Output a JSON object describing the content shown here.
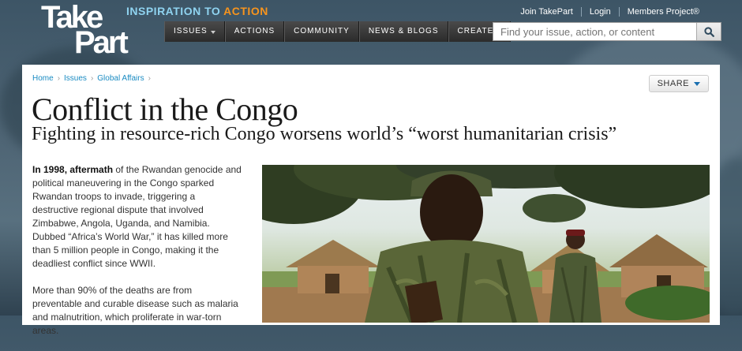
{
  "brand": {
    "logo_line1": "Take",
    "logo_line2": "Part",
    "tagline_prefix": "INSPIRATION TO",
    "tagline_accent": "ACTION"
  },
  "utility_links": [
    "Join TakePart",
    "Login",
    "Members Project®"
  ],
  "nav": [
    {
      "label": "ISSUES",
      "has_caret": true
    },
    {
      "label": "ACTIONS",
      "has_caret": false
    },
    {
      "label": "COMMUNITY",
      "has_caret": false
    },
    {
      "label": "NEWS & BLOGS",
      "has_caret": false
    },
    {
      "label": "CREATE",
      "has_caret": true
    }
  ],
  "search": {
    "placeholder": "Find your issue, action, or content",
    "icon": "search-icon"
  },
  "breadcrumb": [
    "Home",
    "Issues",
    "Global Affairs"
  ],
  "share_label": "SHARE",
  "article": {
    "title": "Conflict in the Congo",
    "subtitle": "Fighting in resource-rich Congo worsens world’s “worst humanitarian crisis”",
    "p1_lead": "In 1998, aftermath",
    "p1_rest": " of the Rwandan genocide and political maneuvering in the Congo sparked Rwandan troops to invade, triggering a destructive regional dispute that involved Zimbabwe, Angola, Uganda, and Namibia. Dubbed “Africa’s World War,” it has killed more than 5 million people in Congo, making it the deadliest conflict since WWII.",
    "p2": "More than 90% of the deaths are from preventable and curable disease such as malaria and malnutrition, which proliferate in war-torn areas."
  },
  "colors": {
    "tagline": "#8fd3f0",
    "accent": "#f7941d",
    "link": "#1a8bc2",
    "share_arrow": "#1a6fb0"
  }
}
